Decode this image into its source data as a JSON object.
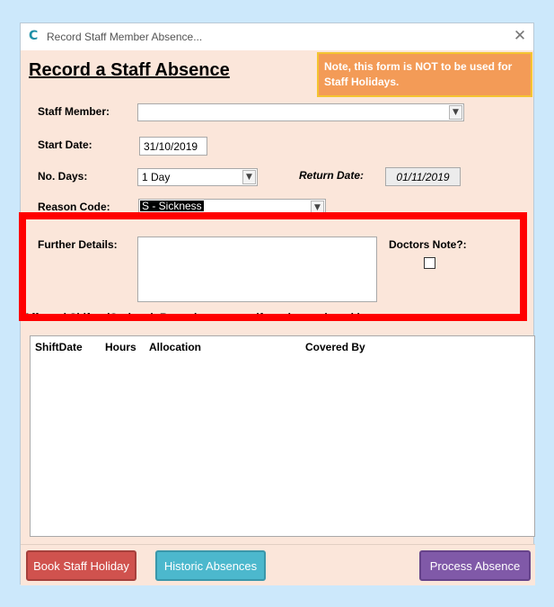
{
  "window": {
    "title": "Record Staff Member Absence...",
    "close_glyph": "✕",
    "app_glyph": "C"
  },
  "form": {
    "heading": "Record a Staff Absence",
    "note": "Note, this form is NOT to be used for Staff Holidays.",
    "staff_member": {
      "label": "Staff Member:",
      "value": ""
    },
    "start_date": {
      "label": "Start Date:",
      "value": "31/10/2019"
    },
    "no_days": {
      "label": "No. Days:",
      "value": "1 Day"
    },
    "return_date": {
      "label": "Return Date:",
      "value": "01/11/2019"
    },
    "reason_code": {
      "label": "Reason Code:",
      "value": "S - Sickness"
    },
    "further_details": {
      "label": "Further Details:",
      "value": ""
    },
    "doctors_note": {
      "label": "Doctors Note?:",
      "checked": false
    },
    "affected_shifts": {
      "label": "Affected Shifts: (Optional: Record cover now if you know about it)"
    }
  },
  "grid": {
    "columns": [
      "ShiftDate",
      "Hours",
      "Allocation",
      "Covered By"
    ],
    "rows": []
  },
  "buttons": {
    "book_holiday": "Book Staff Holiday",
    "historic": "Historic Absences",
    "process": "Process Absence"
  },
  "colors": {
    "form_bg": "#fbe6da",
    "note_bg": "#f39b57",
    "btn_red": "#d0524e",
    "btn_blue": "#4cb8cd",
    "btn_purple": "#8059a8",
    "highlight": "#ff0000"
  },
  "icons": {
    "dropdown": "chevron-down-icon",
    "close": "close-icon",
    "app": "app-logo-icon"
  }
}
